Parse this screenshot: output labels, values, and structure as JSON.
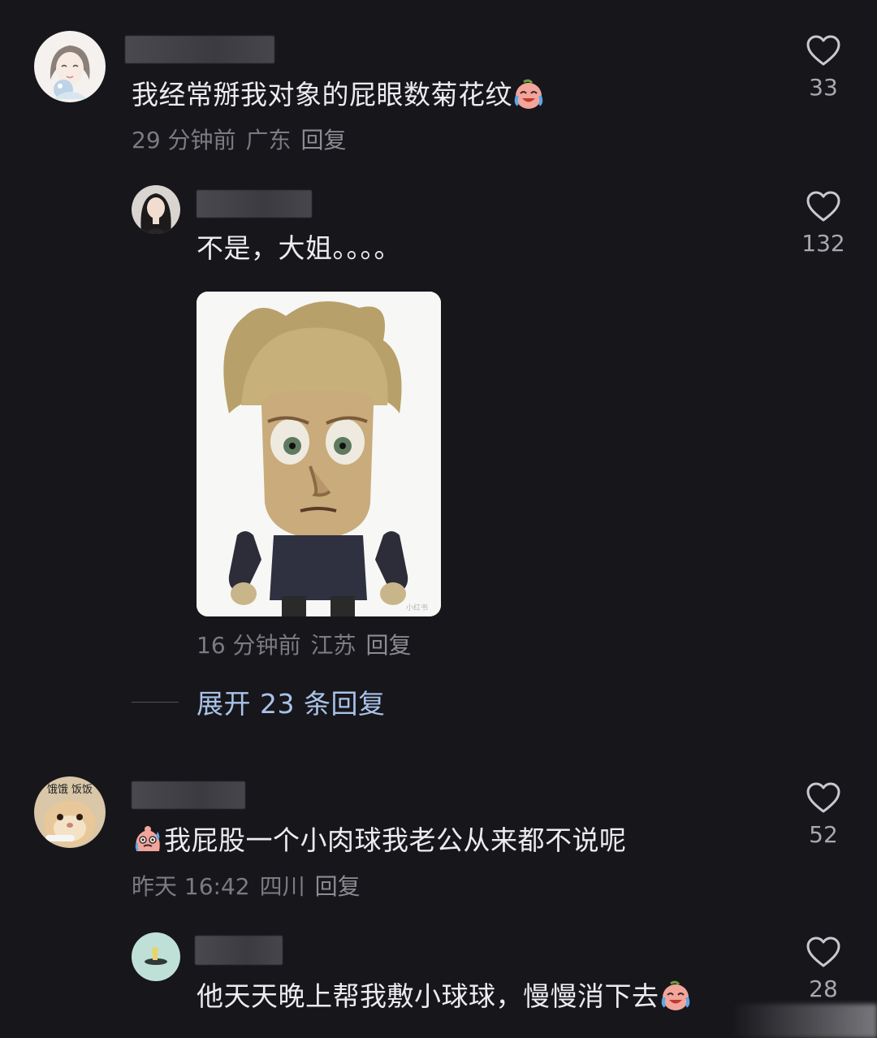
{
  "comments": [
    {
      "text": "我经常掰我对象的屁眼数菊花纹",
      "emoji": "crying-laughing-face",
      "time": "29 分钟前",
      "location": "广东",
      "reply_label": "回复",
      "likes": "33"
    },
    {
      "text": "不是，大姐。。。。",
      "time": "16 分钟前",
      "location": "江苏",
      "reply_label": "回复",
      "likes": "132",
      "has_sticker": true,
      "sticker_watermark": "小红书"
    },
    {
      "text": "我屁股一个小肉球我老公从来都不说呢",
      "emoji": "sweating-face",
      "time": "昨天 16:42",
      "location": "四川",
      "reply_label": "回复",
      "likes": "52",
      "avatar_text": "饿饿 饭饭"
    },
    {
      "text": "他天天晚上帮我敷小球球，慢慢消下去",
      "emoji": "crying-laughing-face",
      "likes": "28"
    }
  ],
  "expand_replies": {
    "label": "展开 23 条回复"
  },
  "colors": {
    "background": "#17161b",
    "text": "#ececef",
    "meta": "#7c7b83",
    "link": "#a9c3e8"
  }
}
